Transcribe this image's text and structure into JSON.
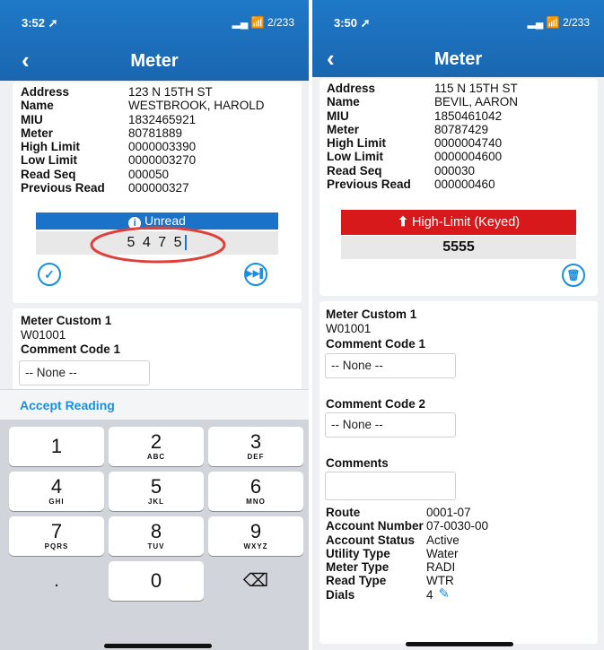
{
  "left": {
    "status_time": "3:52 ➚",
    "status_right": "▂▄ 📶 2/233",
    "back_icon": "chevron-left",
    "title": "Meter",
    "details": [
      {
        "label": "Address",
        "value": "123 N 15TH ST"
      },
      {
        "label": "Name",
        "value": "WESTBROOK, HAROLD"
      },
      {
        "label": "MIU",
        "value": "1832465921"
      },
      {
        "label": "Meter",
        "value": "80781889"
      },
      {
        "label": "High Limit",
        "value": "0000003390"
      },
      {
        "label": "Low Limit",
        "value": "0000003270"
      },
      {
        "label": "Read Seq",
        "value": "000050"
      },
      {
        "label": "Previous Read",
        "value": "000000327"
      }
    ],
    "status_banner": "Unread",
    "reading_value": "5 4 7 5",
    "custom_label": "Meter Custom 1",
    "custom_value": "W01001",
    "comment_code1_label": "Comment Code 1",
    "comment_code1_value": "-- None --",
    "accept_label": "Accept Reading",
    "keys": [
      {
        "d": "1",
        "l": ""
      },
      {
        "d": "2",
        "l": "ABC"
      },
      {
        "d": "3",
        "l": "DEF"
      },
      {
        "d": "4",
        "l": "GHI"
      },
      {
        "d": "5",
        "l": "JKL"
      },
      {
        "d": "6",
        "l": "MNO"
      },
      {
        "d": "7",
        "l": "PQRS"
      },
      {
        "d": "8",
        "l": "TUV"
      },
      {
        "d": "9",
        "l": "WXYZ"
      }
    ],
    "key_dot": ".",
    "key_zero": "0",
    "key_delete": "⌫"
  },
  "right": {
    "status_time": "3:50 ➚",
    "status_right": "▂▄ 📶 2/233",
    "title": "Meter",
    "details": [
      {
        "label": "Address",
        "value": "115 N 15TH ST"
      },
      {
        "label": "Name",
        "value": "BEVIL, AARON"
      },
      {
        "label": "MIU",
        "value": "1850461042"
      },
      {
        "label": "Meter",
        "value": "80787429"
      },
      {
        "label": "High Limit",
        "value": "0000004740"
      },
      {
        "label": "Low Limit",
        "value": "0000004600"
      },
      {
        "label": "Read Seq",
        "value": "000030"
      },
      {
        "label": "Previous Read",
        "value": "000000460"
      }
    ],
    "status_banner": "High-Limit (Keyed)",
    "reading_value": "5555",
    "custom_label": "Meter Custom 1",
    "custom_value": "W01001",
    "comment_code1_label": "Comment Code 1",
    "comment_code1_value": "-- None --",
    "comment_code2_label": "Comment Code 2",
    "comment_code2_value": "-- None --",
    "comments_label": "Comments",
    "comments_value": "",
    "info": [
      {
        "label": "Route",
        "value": "0001-07"
      },
      {
        "label": "Account Number",
        "value": "07-0030-00"
      },
      {
        "label": "Account Status",
        "value": "Active"
      },
      {
        "label": "Utility Type",
        "value": "Water"
      },
      {
        "label": "Meter Type",
        "value": "RADI"
      },
      {
        "label": "Read Type",
        "value": "WTR"
      },
      {
        "label": "Dials",
        "value": "4"
      }
    ]
  },
  "colors": {
    "header_blue": "#1a66b0",
    "unread_blue": "#1a73c8",
    "high_limit_red": "#d7191c",
    "accent_blue": "#1a8fdf",
    "annotation_red": "#e0403a"
  }
}
